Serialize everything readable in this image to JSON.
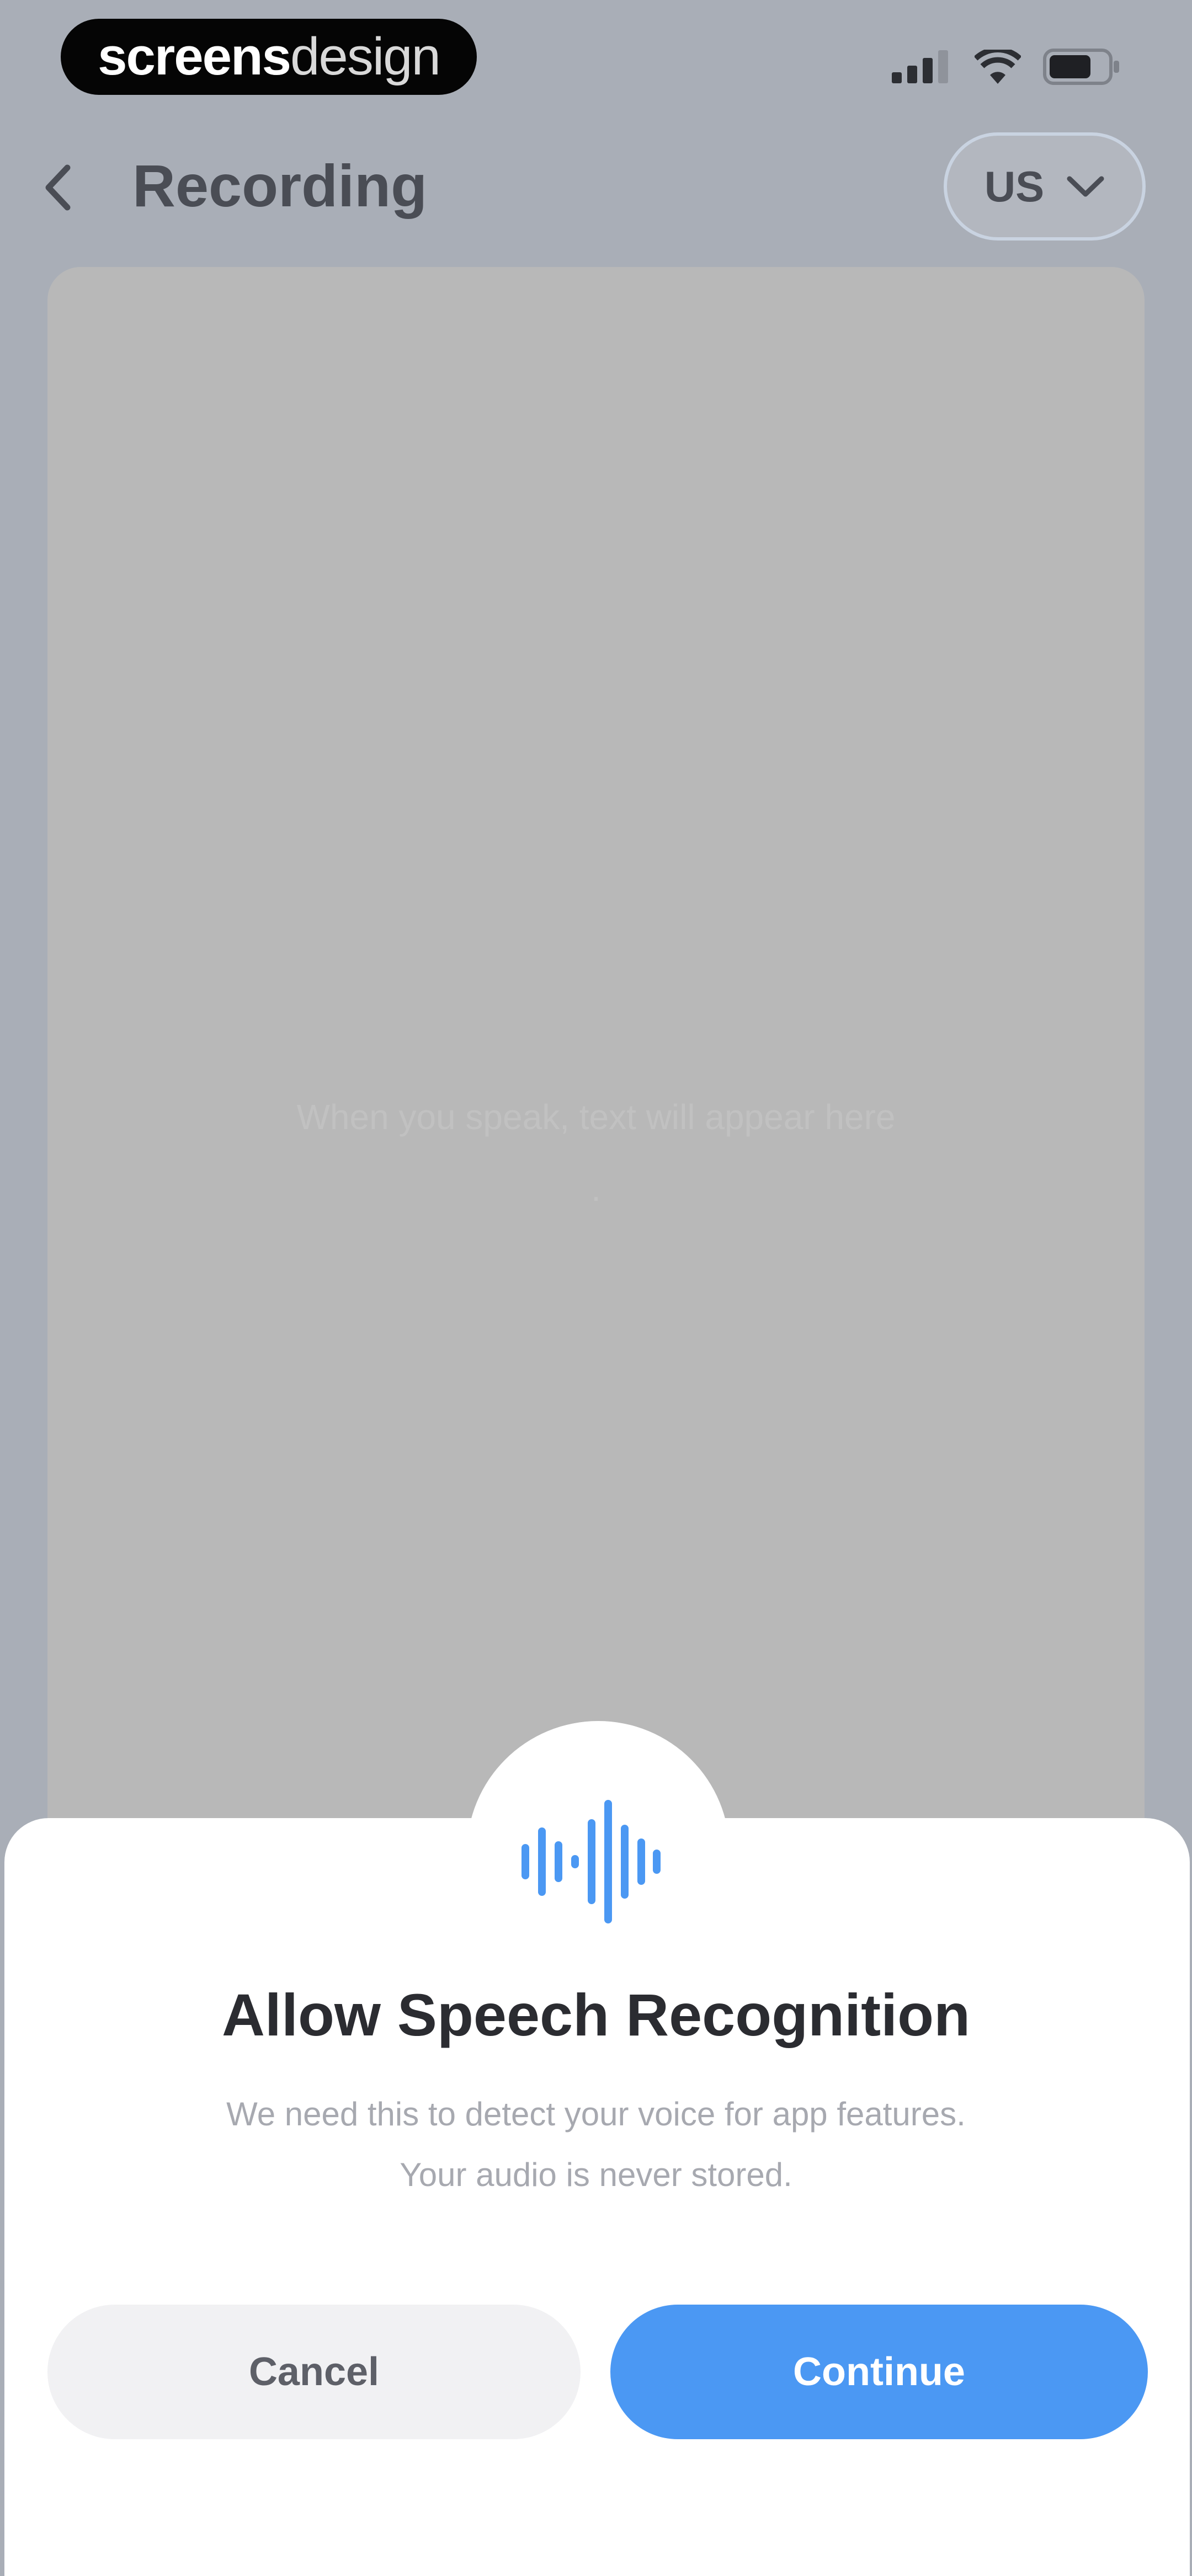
{
  "status_bar": {
    "brand_bold": "screens",
    "brand_thin": "design"
  },
  "header": {
    "title": "Recording",
    "locale": "US"
  },
  "content": {
    "hint_line1": "When you speak, text will appear here",
    "hint_line2": "."
  },
  "dialog": {
    "title": "Allow Speech Recognition",
    "body_line1": "We need this to detect your voice for app features.",
    "body_line2": "Your audio is never stored.",
    "cancel_label": "Cancel",
    "continue_label": "Continue"
  },
  "icons": {
    "back": "chevron-left-icon",
    "locale_dropdown": "chevron-down-icon",
    "signal": "signal-icon",
    "wifi": "wifi-icon",
    "battery": "battery-icon",
    "dialog": "sound-wave-icon"
  },
  "colors": {
    "accent": "#4b98f3",
    "cancel_bg": "#f1f1f3",
    "title": "#2b2c31"
  }
}
